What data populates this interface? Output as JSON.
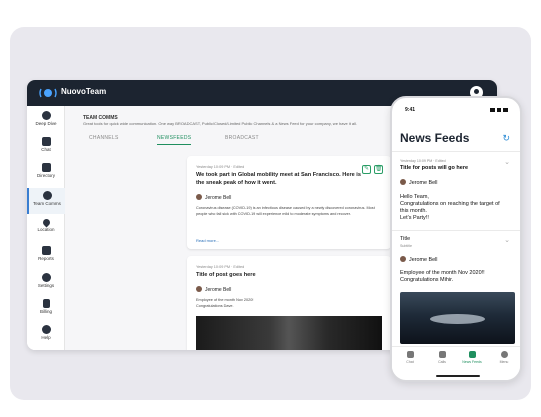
{
  "app": {
    "brand": "NuovoTeam"
  },
  "sidebar": {
    "items": [
      {
        "label": "Deep Dive",
        "icon": "pie-chart-icon"
      },
      {
        "label": "Chat",
        "icon": "chat-icon"
      },
      {
        "label": "Directory",
        "icon": "directory-icon"
      },
      {
        "label": "Team Comms",
        "icon": "team-comms-icon",
        "active": true
      },
      {
        "label": "Location",
        "icon": "location-pin-icon"
      },
      {
        "label": "Reports",
        "icon": "reports-icon"
      },
      {
        "label": "Settings",
        "icon": "gear-icon"
      },
      {
        "label": "Billing",
        "icon": "billing-icon"
      },
      {
        "label": "Help",
        "icon": "help-icon"
      }
    ]
  },
  "main": {
    "heading": "TEAM COMMS",
    "subheading": "Great tools for quick wide communication. One way BROADCAST, Public/Closed/Limited Public Channels & a News Feed for your company, we have it all.",
    "tabs": [
      "CHANNELS",
      "NEWSFEEDS",
      "BROADCAST"
    ],
    "active_tab": "NEWSFEEDS",
    "posts": [
      {
        "meta": "Yesterday 10:09 PM  ·  Edited",
        "title": "We took part in Global mobility meet at San Francisco. Here is the sneak peak of how it went.",
        "author": "Jerome Bell",
        "body": "Coronavirus disease (COVID-19) is an infectious disease caused by a newly discovered coronavirus. Most people who fall sick with COVID-19 will experience mild to moderate symptoms and recover.",
        "read_more": "Read more..."
      },
      {
        "meta": "Yesterday 10:09 PM  ·  Edited",
        "title": "Title of post goes here",
        "author": "Jerome Bell",
        "body_line1": "Employee of the month Nov 2020!",
        "body_line2": "Congratulations Dave."
      }
    ]
  },
  "phone": {
    "time": "9:41",
    "title": "News Feeds",
    "posts": [
      {
        "meta": "Yesterday 10:09 PM  ·  Edited",
        "title": "Title for posts will go here",
        "author": "Jerome Bell",
        "line1": "Hello Team,",
        "line2": "Congratulations on reaching the target of",
        "line3": "this month.",
        "line4": "Let's Party!!"
      },
      {
        "title": "Title",
        "subtitle": "Subtitle",
        "author": "Jerome Bell",
        "line1": "Employee of the month Nov 2020!!",
        "line2": "Congratulations Mihir."
      }
    ],
    "tabbar": [
      {
        "label": "Chat",
        "icon": "chat-icon"
      },
      {
        "label": "Calls",
        "icon": "phone-icon"
      },
      {
        "label": "News Feeds",
        "icon": "news-feed-icon",
        "active": true
      },
      {
        "label": "Menu",
        "icon": "menu-icon"
      }
    ]
  },
  "colors": {
    "accent": "#1f8f5f",
    "topbar": "#1c2430",
    "link": "#2a6fb8"
  }
}
